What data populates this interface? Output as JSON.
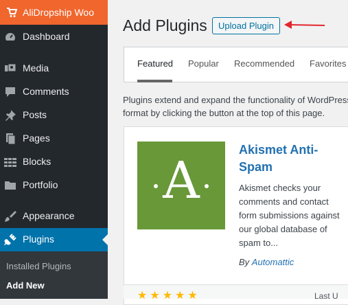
{
  "sidebar": {
    "brand": "AliDropship Woo",
    "items": [
      {
        "label": "Dashboard",
        "icon": "dashboard-icon"
      },
      {
        "label": "Media",
        "icon": "media-icon"
      },
      {
        "label": "Comments",
        "icon": "comments-icon"
      },
      {
        "label": "Posts",
        "icon": "pushpin-icon"
      },
      {
        "label": "Pages",
        "icon": "pages-icon"
      },
      {
        "label": "Blocks",
        "icon": "blocks-icon"
      },
      {
        "label": "Portfolio",
        "icon": "folder-icon"
      },
      {
        "label": "Appearance",
        "icon": "paintbrush-icon"
      },
      {
        "label": "Plugins",
        "icon": "plugin-icon",
        "active": true
      }
    ],
    "submenu": [
      {
        "label": "Installed Plugins"
      },
      {
        "label": "Add New",
        "current": true
      }
    ]
  },
  "header": {
    "title": "Add Plugins",
    "upload_button": "Upload Plugin"
  },
  "tabs": [
    {
      "label": "Featured",
      "current": true
    },
    {
      "label": "Popular"
    },
    {
      "label": "Recommended"
    },
    {
      "label": "Favorites"
    }
  ],
  "description": {
    "line1": "Plugins extend and expand the functionality of WordPress.",
    "line2": "format by clicking the button at the top of this page."
  },
  "plugin_card": {
    "icon_letter": "A",
    "name": "Akismet Anti-Spam",
    "description": "Akismet checks your comments and contact form submissions against our global database of spam to...",
    "author_prefix": "By",
    "author": "Automattic",
    "stars": "★★★★★",
    "footer_right": "Last U"
  },
  "colors": {
    "sidebar_bg": "#23282d",
    "brand_bg": "#f0662d",
    "active_bg": "#0073aa",
    "link": "#2271b1",
    "akismet_green": "#699838",
    "arrow": "#e3262d"
  }
}
